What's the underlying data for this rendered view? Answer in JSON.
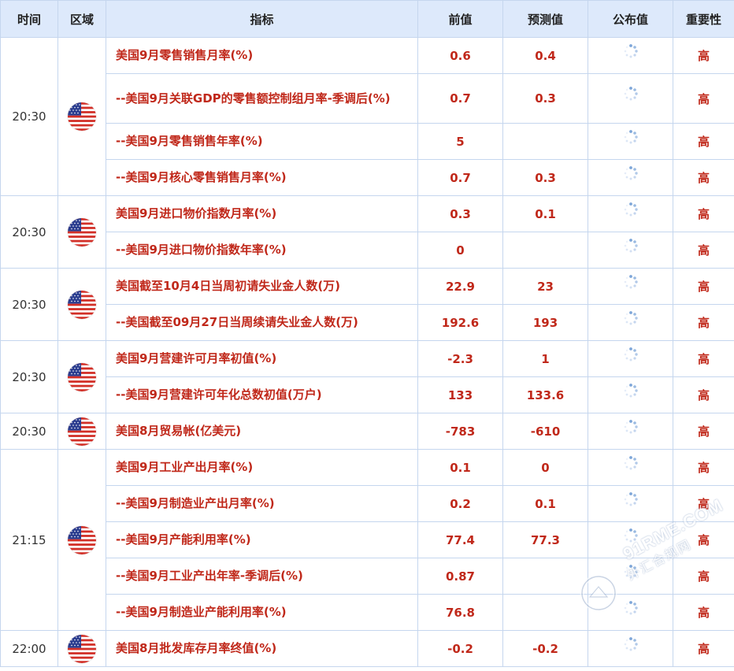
{
  "headers": {
    "time": "时间",
    "region": "区域",
    "indicator": "指标",
    "previous": "前值",
    "forecast": "预测值",
    "actual": "公布值",
    "importance": "重要性"
  },
  "flag_icon": "us-flag-icon",
  "loading_icon": "loading-spinner-icon",
  "colors": {
    "header_bg": "#dde9fb",
    "value_red": "#c0281a",
    "border": "#c5d6ee"
  },
  "watermark": {
    "site": "91RME.COM",
    "sub": "外汇合规网"
  },
  "groups": [
    {
      "time": "20:30",
      "rows": [
        {
          "indicator": "美国9月零售销售月率(%)",
          "previous": "0.6",
          "forecast": "0.4",
          "importance": "高"
        },
        {
          "indicator": "--美国9月关联GDP的零售额控制组月率-季调后(%)",
          "previous": "0.7",
          "forecast": "0.3",
          "importance": "高"
        },
        {
          "indicator": "--美国9月零售销售年率(%)",
          "previous": "5",
          "forecast": "",
          "importance": "高"
        },
        {
          "indicator": "--美国9月核心零售销售月率(%)",
          "previous": "0.7",
          "forecast": "0.3",
          "importance": "高"
        }
      ]
    },
    {
      "time": "20:30",
      "rows": [
        {
          "indicator": "美国9月进口物价指数月率(%)",
          "previous": "0.3",
          "forecast": "0.1",
          "importance": "高"
        },
        {
          "indicator": "--美国9月进口物价指数年率(%)",
          "previous": "0",
          "forecast": "",
          "importance": "高"
        }
      ]
    },
    {
      "time": "20:30",
      "rows": [
        {
          "indicator": "美国截至10月4日当周初请失业金人数(万)",
          "previous": "22.9",
          "forecast": "23",
          "importance": "高"
        },
        {
          "indicator": "--美国截至09月27日当周续请失业金人数(万)",
          "previous": "192.6",
          "forecast": "193",
          "importance": "高"
        }
      ]
    },
    {
      "time": "20:30",
      "rows": [
        {
          "indicator": "美国9月营建许可月率初值(%)",
          "previous": "-2.3",
          "forecast": "1",
          "importance": "高"
        },
        {
          "indicator": "--美国9月营建许可年化总数初值(万户)",
          "previous": "133",
          "forecast": "133.6",
          "importance": "高"
        }
      ]
    },
    {
      "time": "20:30",
      "rows": [
        {
          "indicator": "美国8月贸易帐(亿美元)",
          "previous": "-783",
          "forecast": "-610",
          "importance": "高"
        }
      ]
    },
    {
      "time": "21:15",
      "rows": [
        {
          "indicator": "美国9月工业产出月率(%)",
          "previous": "0.1",
          "forecast": "0",
          "importance": "高"
        },
        {
          "indicator": "--美国9月制造业产出月率(%)",
          "previous": "0.2",
          "forecast": "0.1",
          "importance": "高"
        },
        {
          "indicator": "--美国9月产能利用率(%)",
          "previous": "77.4",
          "forecast": "77.3",
          "importance": "高"
        },
        {
          "indicator": "--美国9月工业产出年率-季调后(%)",
          "previous": "0.87",
          "forecast": "",
          "importance": "高"
        },
        {
          "indicator": "--美国9月制造业产能利用率(%)",
          "previous": "76.8",
          "forecast": "",
          "importance": "高"
        }
      ]
    },
    {
      "time": "22:00",
      "rows": [
        {
          "indicator": "美国8月批发库存月率终值(%)",
          "previous": "-0.2",
          "forecast": "-0.2",
          "importance": "高"
        }
      ]
    }
  ]
}
